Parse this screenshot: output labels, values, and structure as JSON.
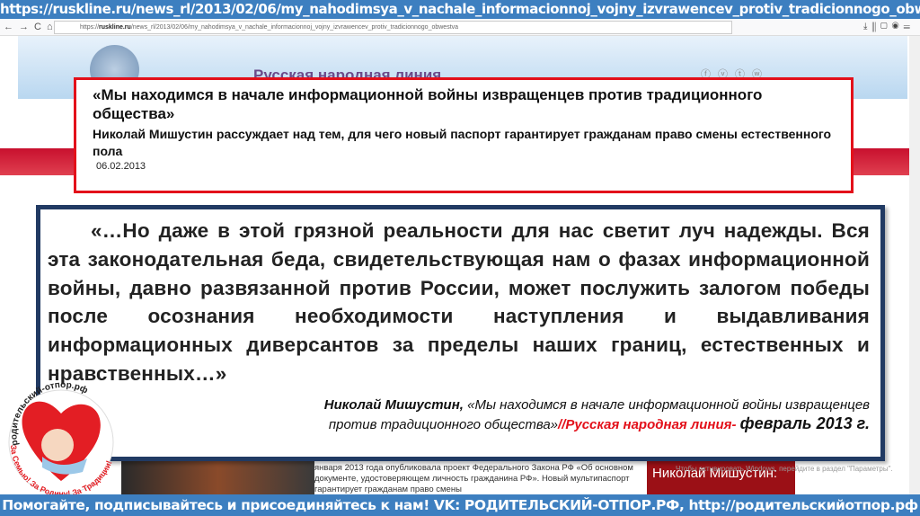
{
  "title_bar": {
    "url": "https://ruskline.ru/news_rl/2013/02/06/my_nahodimsya_v_nachale_informacionnoj_vojny_izvrawencev_protiv_tradicionnogo_obwestva"
  },
  "browser": {
    "address_prefix": "https://",
    "address_domain": "ruskline.ru",
    "address_path": "/news_rl/2013/02/06/my_nahodimsya_v_nachale_informacionnoj_vojny_izvrawencev_protiv_tradicionnogo_obwestva"
  },
  "site": {
    "name": "Русская народная линия"
  },
  "headline_box": {
    "title": "«Мы находимся в начале информационной войны извращенцев против традиционного общества»",
    "subtitle": "Николай Мишустин рассуждает над тем, для чего новый паспорт гарантирует гражданам право смены естественного пола",
    "date": "06.02.2013"
  },
  "quote_box": {
    "quote": "«…Но даже в этой грязной реальности для нас светит луч надежды. Вся эта законодательная беда, свидетельствующая нам о фазах информационной войны, давно развязанной против России, может послужить залогом победы после осознания необходимости наступления и выдавливания информационных диверсантов за пределы наших границ, естественных и нравственных…»",
    "author": "Николай Мишустин,",
    "article_title": "«Мы находимся в начале информационной войны извращенцев против традиционного общества»",
    "source": "//Русская народная линия-",
    "date": "февраль 2013 г."
  },
  "article": {
    "snippet": "января 2013 года опубликовала проект Федерального Закона РФ «Об основном документе, удостоверяющем личность гражданина РФ». Новый мультипаспорт гарантирует гражданам право смены",
    "card": "Николай Мишустин:",
    "watermark": "Чтобы активировать Windows, перейдите в раздел \"Параметры\"."
  },
  "logo": {
    "top_text": "родительский-отпор.рф",
    "bottom_text": "За Семью! За Родину! За Традиции!"
  },
  "bottom_bar": {
    "text": "Помогайте, подписывайтесь и присоединяйтесь к нам! VK: РОДИТЕЛЬСКИЙ-ОТПОР.РФ, http://родительскийотпор.рф"
  }
}
